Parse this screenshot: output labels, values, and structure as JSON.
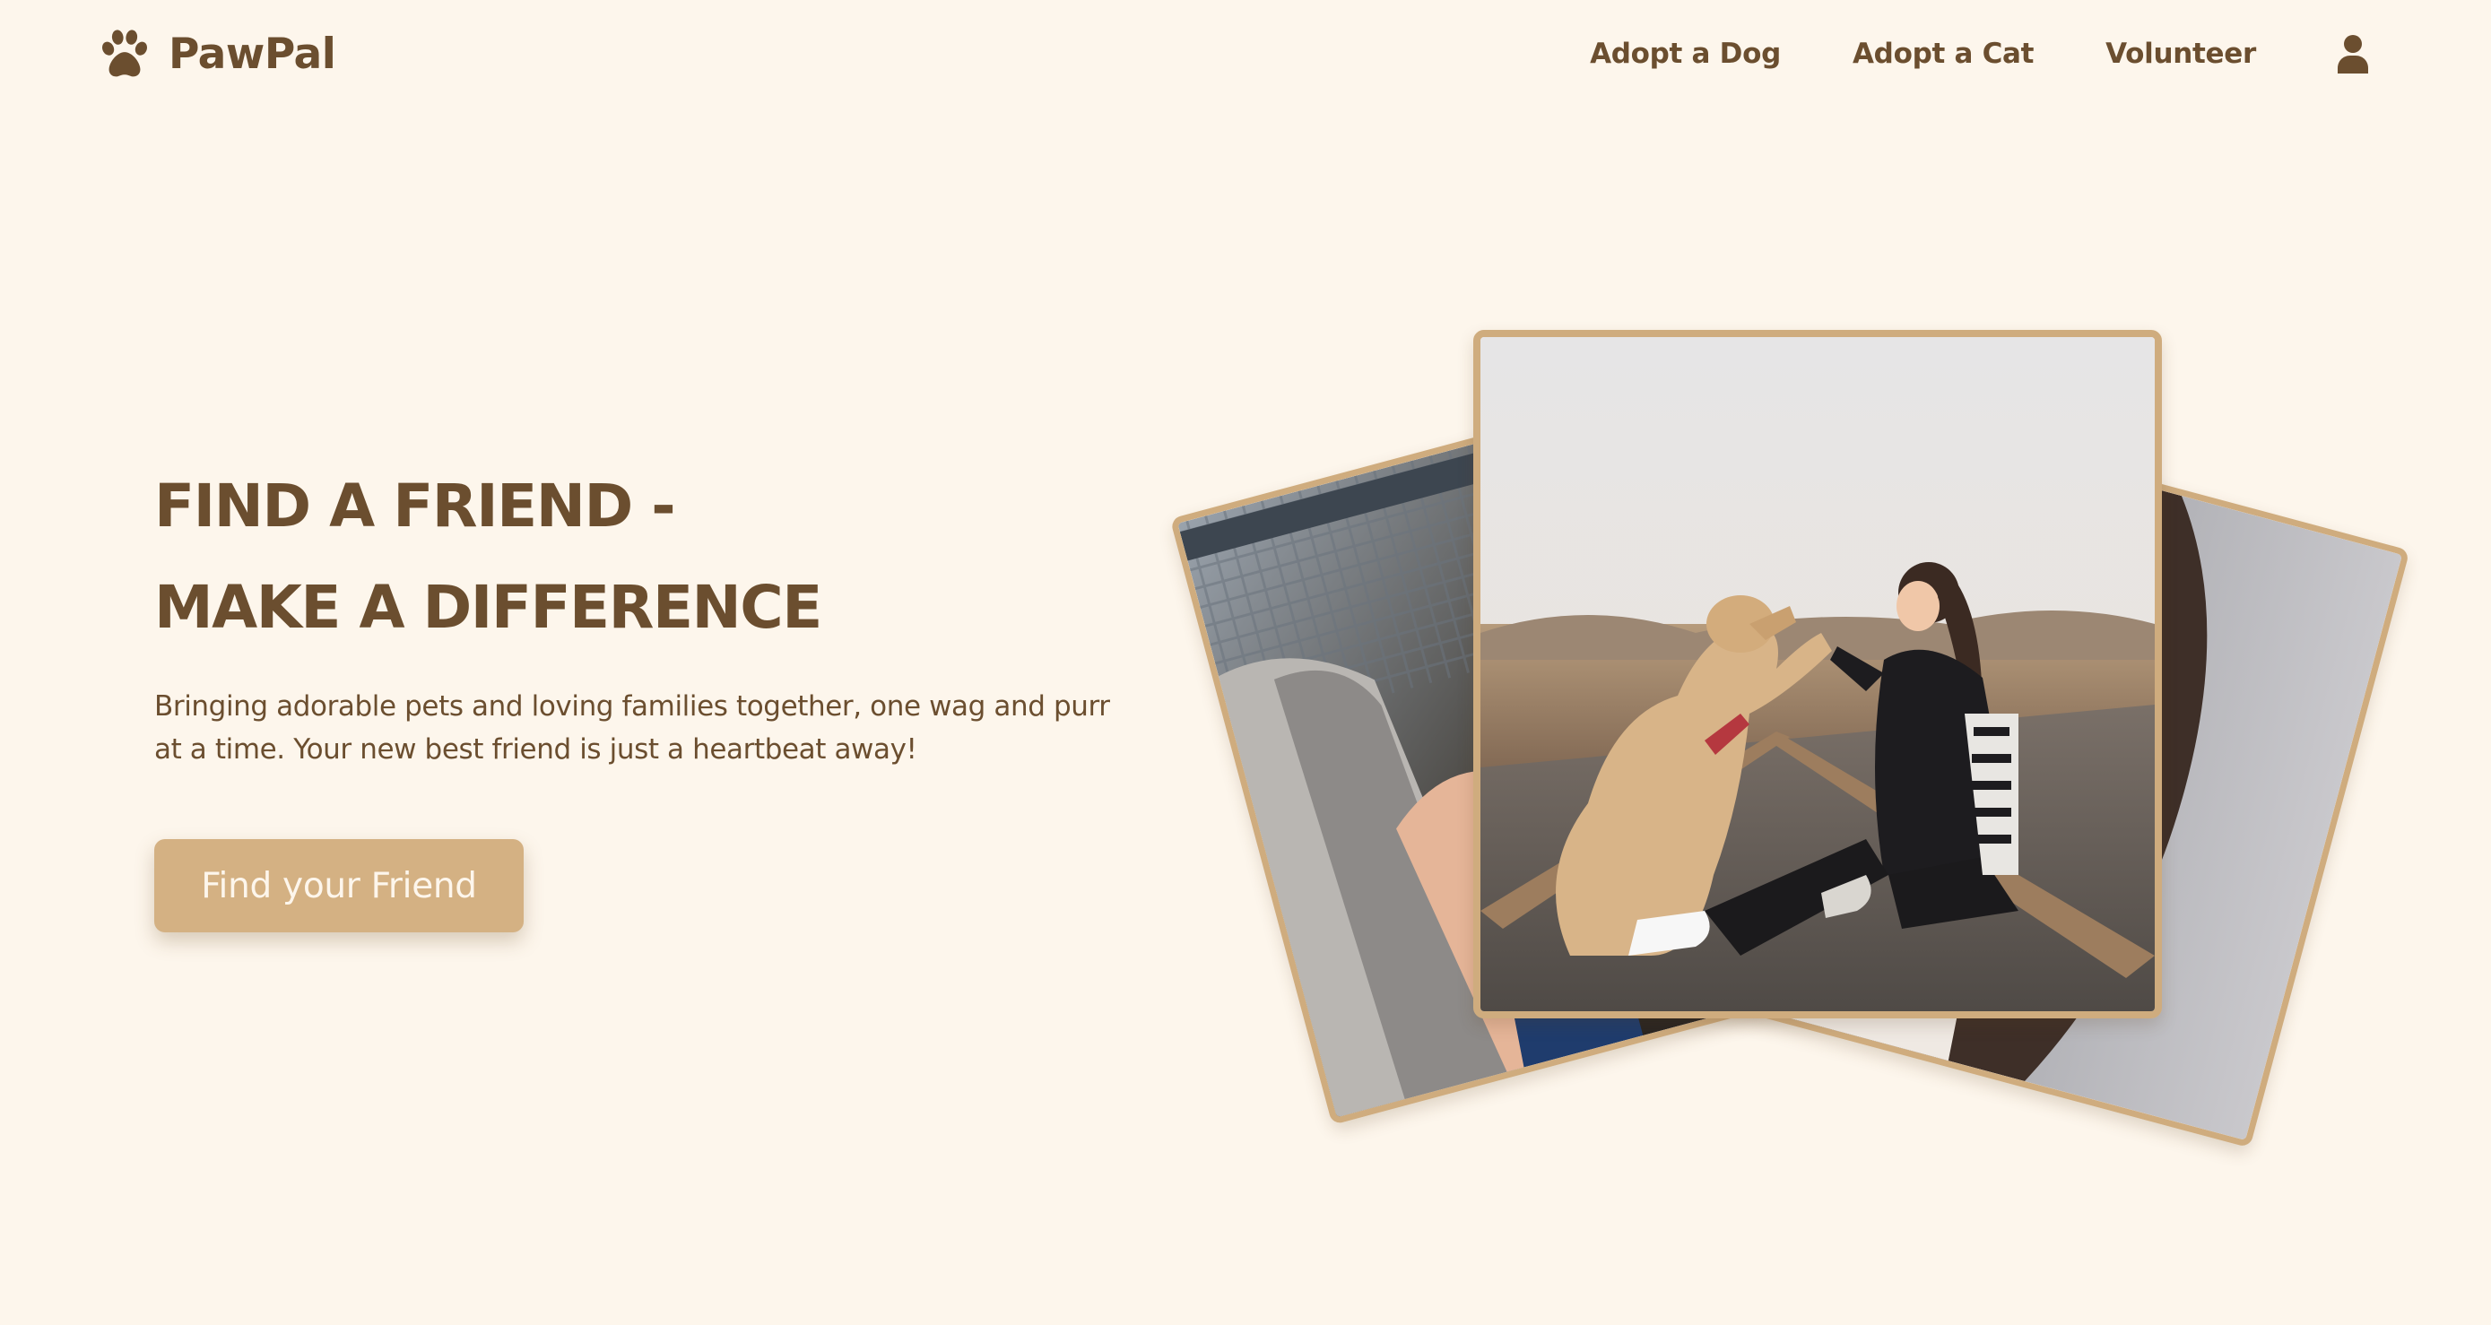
{
  "brand": {
    "name": "PawPal",
    "logo_icon": "paw-icon"
  },
  "nav": {
    "items": [
      {
        "label": "Adopt a Dog"
      },
      {
        "label": "Adopt a Cat"
      },
      {
        "label": "Volunteer"
      }
    ],
    "account_icon": "user-icon"
  },
  "hero": {
    "title_line1": "FIND A FRIEND -",
    "title_line2": "MAKE A DIFFERENCE",
    "subtitle": "Bringing adorable pets and loving families together, one wag and purr at a time. Your new best friend is just a heartbeat away!",
    "cta_label": "Find your Friend"
  },
  "photos": [
    {
      "subject": "person holding a pet (blurred)",
      "position": "back-left"
    },
    {
      "subject": "woman high-fiving a golden retriever on railway tracks",
      "position": "front-center"
    },
    {
      "subject": "close-up of a cat with a blue collar",
      "position": "back-right"
    }
  ],
  "colors": {
    "background": "#fdf6ec",
    "text": "#6b4e2f",
    "accent": "#d4b183",
    "frame": "#cfac7e"
  }
}
